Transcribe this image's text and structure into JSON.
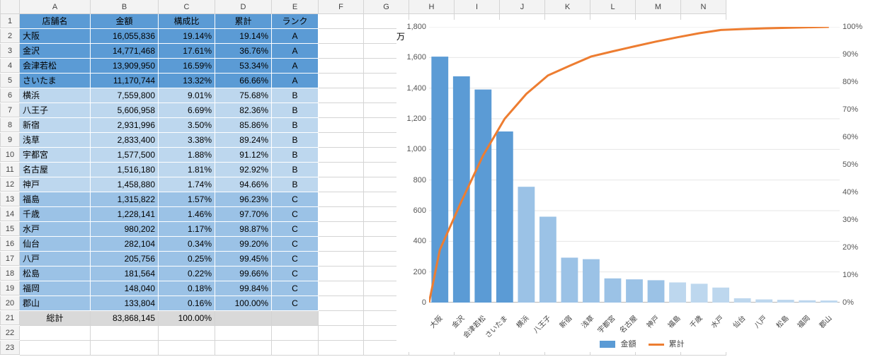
{
  "columns": [
    "A",
    "B",
    "C",
    "D",
    "E",
    "F",
    "G",
    "H",
    "I",
    "J",
    "K",
    "L",
    "M",
    "N"
  ],
  "headers": {
    "store": "店舗名",
    "amount": "金額",
    "ratio": "構成比",
    "cum": "累計",
    "rank": "ランク"
  },
  "rows": [
    {
      "r": 2,
      "store": "大阪",
      "amount": "16,055,836",
      "ratio": "19.14%",
      "cum": "19.14%",
      "rank": "A",
      "band": "A"
    },
    {
      "r": 3,
      "store": "金沢",
      "amount": "14,771,468",
      "ratio": "17.61%",
      "cum": "36.76%",
      "rank": "A",
      "band": "A"
    },
    {
      "r": 4,
      "store": "会津若松",
      "amount": "13,909,950",
      "ratio": "16.59%",
      "cum": "53.34%",
      "rank": "A",
      "band": "A"
    },
    {
      "r": 5,
      "store": "さいたま",
      "amount": "11,170,744",
      "ratio": "13.32%",
      "cum": "66.66%",
      "rank": "A",
      "band": "A"
    },
    {
      "r": 6,
      "store": "横浜",
      "amount": "7,559,800",
      "ratio": "9.01%",
      "cum": "75.68%",
      "rank": "B",
      "band": "B"
    },
    {
      "r": 7,
      "store": "八王子",
      "amount": "5,606,958",
      "ratio": "6.69%",
      "cum": "82.36%",
      "rank": "B",
      "band": "B"
    },
    {
      "r": 8,
      "store": "新宿",
      "amount": "2,931,996",
      "ratio": "3.50%",
      "cum": "85.86%",
      "rank": "B",
      "band": "B"
    },
    {
      "r": 9,
      "store": "浅草",
      "amount": "2,833,400",
      "ratio": "3.38%",
      "cum": "89.24%",
      "rank": "B",
      "band": "B"
    },
    {
      "r": 10,
      "store": "宇都宮",
      "amount": "1,577,500",
      "ratio": "1.88%",
      "cum": "91.12%",
      "rank": "B",
      "band": "B"
    },
    {
      "r": 11,
      "store": "名古屋",
      "amount": "1,516,180",
      "ratio": "1.81%",
      "cum": "92.92%",
      "rank": "B",
      "band": "B"
    },
    {
      "r": 12,
      "store": "神戸",
      "amount": "1,458,880",
      "ratio": "1.74%",
      "cum": "94.66%",
      "rank": "B",
      "band": "B"
    },
    {
      "r": 13,
      "store": "福島",
      "amount": "1,315,822",
      "ratio": "1.57%",
      "cum": "96.23%",
      "rank": "C",
      "band": "C"
    },
    {
      "r": 14,
      "store": "千歳",
      "amount": "1,228,141",
      "ratio": "1.46%",
      "cum": "97.70%",
      "rank": "C",
      "band": "C"
    },
    {
      "r": 15,
      "store": "水戸",
      "amount": "980,202",
      "ratio": "1.17%",
      "cum": "98.87%",
      "rank": "C",
      "band": "C"
    },
    {
      "r": 16,
      "store": "仙台",
      "amount": "282,104",
      "ratio": "0.34%",
      "cum": "99.20%",
      "rank": "C",
      "band": "C"
    },
    {
      "r": 17,
      "store": "八戸",
      "amount": "205,756",
      "ratio": "0.25%",
      "cum": "99.45%",
      "rank": "C",
      "band": "C"
    },
    {
      "r": 18,
      "store": "松島",
      "amount": "181,564",
      "ratio": "0.22%",
      "cum": "99.66%",
      "rank": "C",
      "band": "C"
    },
    {
      "r": 19,
      "store": "福岡",
      "amount": "148,040",
      "ratio": "0.18%",
      "cum": "99.84%",
      "rank": "C",
      "band": "C"
    },
    {
      "r": 20,
      "store": "郡山",
      "amount": "133,804",
      "ratio": "0.16%",
      "cum": "100.00%",
      "rank": "C",
      "band": "C"
    }
  ],
  "total": {
    "r": 21,
    "label": "総計",
    "amount": "83,868,145",
    "ratio": "100.00%"
  },
  "empty_rows": [
    22,
    23
  ],
  "chart_data": {
    "type": "pareto",
    "unit_label": "万",
    "categories": [
      "大阪",
      "金沢",
      "会津若松",
      "さいたま",
      "横浜",
      "八王子",
      "新宿",
      "浅草",
      "宇都宮",
      "名古屋",
      "神戸",
      "福島",
      "千歳",
      "水戸",
      "仙台",
      "八戸",
      "松島",
      "福岡",
      "郡山"
    ],
    "series": [
      {
        "name": "金額",
        "type": "bar",
        "axis": "left_万",
        "values": [
          1605.6,
          1477.1,
          1391.0,
          1117.1,
          756.0,
          560.7,
          293.2,
          283.3,
          157.8,
          151.6,
          145.9,
          131.6,
          122.8,
          98.0,
          28.2,
          20.6,
          18.2,
          14.8,
          13.4
        ]
      },
      {
        "name": "累計",
        "type": "line",
        "axis": "right_pct",
        "values": [
          19.14,
          36.76,
          53.34,
          66.66,
          75.68,
          82.36,
          85.86,
          89.24,
          91.12,
          92.92,
          94.66,
          96.23,
          97.7,
          98.87,
          99.2,
          99.45,
          99.66,
          99.84,
          100.0
        ]
      }
    ],
    "bar_rank": [
      "A",
      "A",
      "A",
      "A",
      "B",
      "B",
      "B",
      "B",
      "B",
      "B",
      "B",
      "C",
      "C",
      "C",
      "C",
      "C",
      "C",
      "C",
      "C"
    ],
    "y_left": {
      "min": 0,
      "max": 1800,
      "step": 200,
      "label": ""
    },
    "y_right": {
      "min": 0,
      "max": 100,
      "step": 10,
      "suffix": "%"
    },
    "legend_pos": "bottom"
  }
}
